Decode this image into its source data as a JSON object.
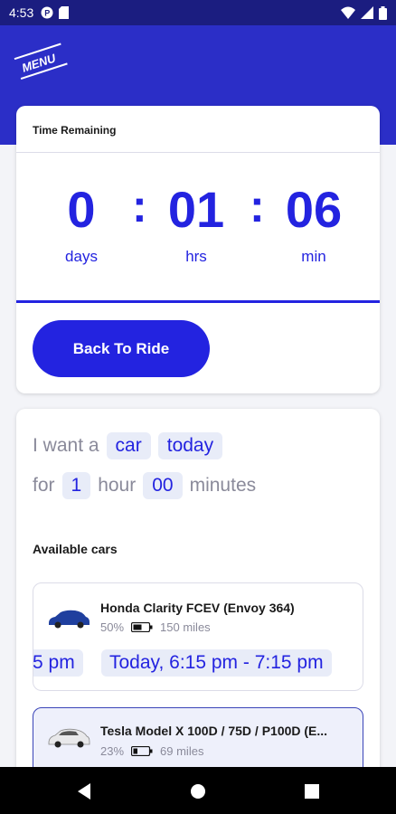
{
  "status_bar": {
    "time": "4:53"
  },
  "timer": {
    "title": "Time Remaining",
    "days": "0",
    "hrs": "01",
    "min": "06",
    "separator": ":",
    "days_label": "days",
    "hrs_label": "hrs",
    "min_label": "min",
    "button": "Back To Ride"
  },
  "booking": {
    "sentence1_prefix": "I want a",
    "vehicle": "car",
    "when": "today",
    "sentence2_prefix": "for",
    "hours": "1",
    "hours_label": "hour",
    "minutes": "00",
    "minutes_label": "minutes",
    "available_label": "Available cars"
  },
  "cars": [
    {
      "name": "Honda Clarity FCEV (Envoy 364)",
      "charge": "50%",
      "range": "150 miles",
      "color": "#1f3f9e",
      "slots": [
        "5 pm",
        "Today, 6:15 pm - 7:15 pm"
      ]
    },
    {
      "name": "Tesla Model X 100D / 75D / P100D (E...",
      "charge": "23%",
      "range": "69 miles",
      "color": "#e8e8ea",
      "slots": []
    }
  ],
  "colors": {
    "brand": "#2b2ec7",
    "accent": "#2323e0",
    "chip_bg": "#e8ecf8"
  }
}
